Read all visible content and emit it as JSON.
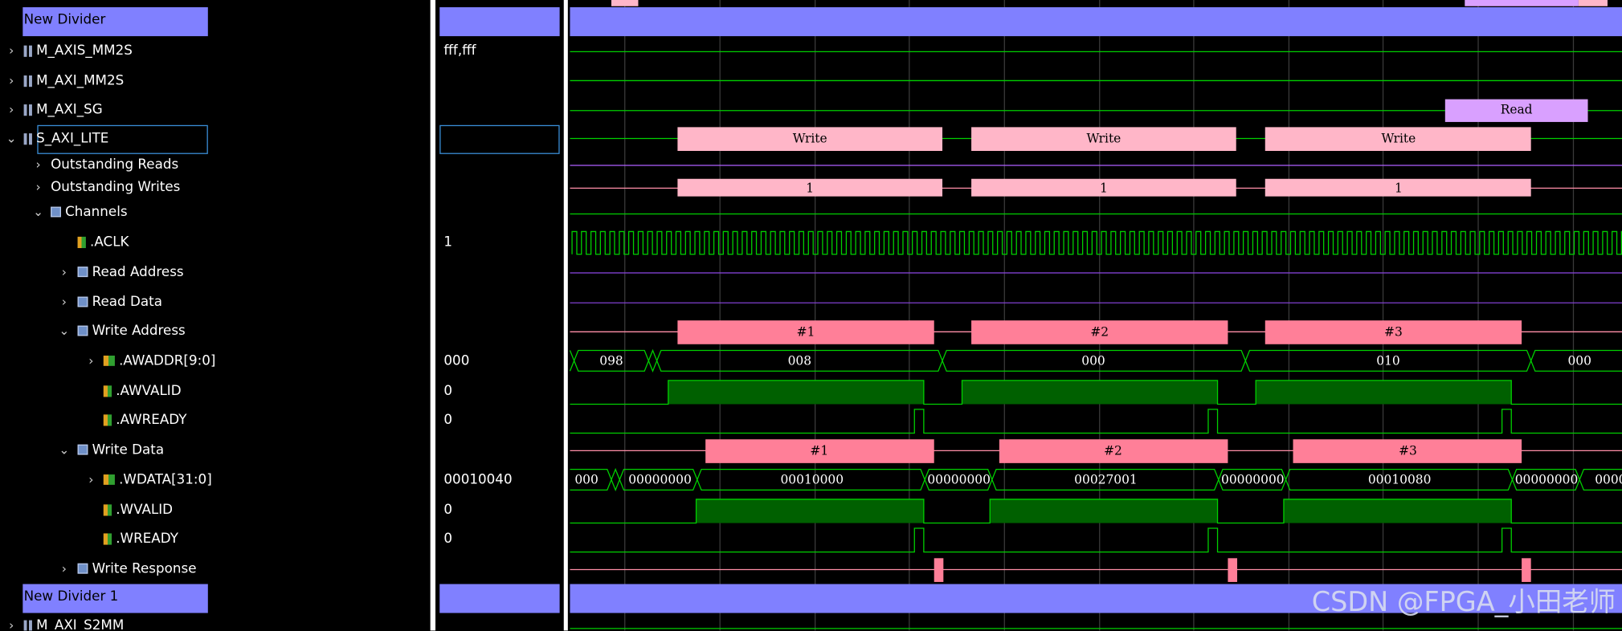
{
  "dividers": {
    "top": "New Divider",
    "bottom": "New Divider 1"
  },
  "rows": [
    {
      "key": "m_axis_mm2s",
      "label": "M_AXIS_MM2S",
      "value": "fff,fff"
    },
    {
      "key": "m_axi_mm2s",
      "label": "M_AXI_MM2S",
      "value": ""
    },
    {
      "key": "m_axi_sg",
      "label": "M_AXI_SG",
      "value": ""
    },
    {
      "key": "s_axi_lite",
      "label": "S_AXI_LITE",
      "value": ""
    },
    {
      "key": "outstanding_reads",
      "label": "Outstanding Reads",
      "value": ""
    },
    {
      "key": "outstanding_writes",
      "label": "Outstanding Writes",
      "value": ""
    },
    {
      "key": "channels",
      "label": "Channels",
      "value": ""
    },
    {
      "key": "aclk",
      "label": ".ACLK",
      "value": "1"
    },
    {
      "key": "read_address",
      "label": "Read Address",
      "value": ""
    },
    {
      "key": "read_data",
      "label": "Read Data",
      "value": ""
    },
    {
      "key": "write_address",
      "label": "Write Address",
      "value": ""
    },
    {
      "key": "awaddr",
      "label": ".AWADDR[9:0]",
      "value": "000"
    },
    {
      "key": "awvalid",
      "label": ".AWVALID",
      "value": "0"
    },
    {
      "key": "awready",
      "label": ".AWREADY",
      "value": "0"
    },
    {
      "key": "write_data",
      "label": "Write Data",
      "value": ""
    },
    {
      "key": "wdata",
      "label": ".WDATA[31:0]",
      "value": "00010040"
    },
    {
      "key": "wvalid",
      "label": ".WVALID",
      "value": "0"
    },
    {
      "key": "wready",
      "label": ".WREADY",
      "value": "0"
    },
    {
      "key": "write_response",
      "label": "Write Response",
      "value": ""
    },
    {
      "key": "m_axi_s2mm",
      "label": "M_AXI_S2MM",
      "value": ""
    }
  ],
  "transactions": {
    "read": "Read",
    "write": [
      "Write",
      "Write",
      "Write"
    ],
    "outstanding": [
      "1",
      "1",
      "1"
    ],
    "write_address": [
      "#1",
      "#2",
      "#3"
    ],
    "write_data": [
      "#1",
      "#2",
      "#3"
    ]
  },
  "buses": {
    "awaddr": [
      "098",
      "008",
      "000",
      "010",
      "000"
    ],
    "wdata": [
      "000",
      "00000000",
      "00010000",
      "00000000",
      "00027001",
      "00000000",
      "00010080",
      "00000000",
      "0000"
    ]
  },
  "watermark": "CSDN @FPGA_小田老师",
  "colors": {
    "divider": "#8080ff",
    "wave": "#00d000",
    "write_txn": "#ffb6c8",
    "read_txn": "#d9a0ff",
    "channel_txn": "#ff7f98"
  }
}
